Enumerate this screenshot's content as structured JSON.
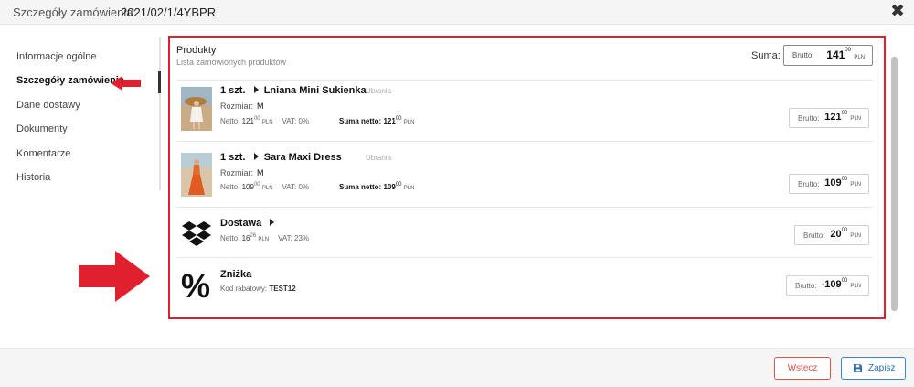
{
  "header": {
    "label": "Szczegóły zamówienia:",
    "order_id": "2021/02/1/4YBPR",
    "close_icon": "close-icon"
  },
  "nav": {
    "items": [
      {
        "label": "Informacje ogólne"
      },
      {
        "label": "Szczegóły zamówienia"
      },
      {
        "label": "Dane dostawy"
      },
      {
        "label": "Dokumenty"
      },
      {
        "label": "Komentarze"
      },
      {
        "label": "Historia"
      }
    ],
    "active_index": 1
  },
  "products": {
    "title": "Produkty",
    "subtitle": "Lista zamówionych produktów",
    "suma_label": "Suma:",
    "suma_brutto_label": "Brutto:",
    "suma_value": "141",
    "suma_cents": "00",
    "currency": "PLN",
    "items": [
      {
        "qty": "1 szt.",
        "name": "Lniana Mini Sukienka",
        "category": "Ubrania",
        "size_label": "Rozmiar:",
        "size": "M",
        "netto_label": "Netto:",
        "netto": "121",
        "netto_cents": "00",
        "vat": "VAT: 0%",
        "sum_netto_label": "Suma netto:",
        "sum_netto": "121",
        "sum_netto_cents": "00",
        "brutto_label": "Brutto:",
        "brutto": "121",
        "brutto_cents": "00"
      },
      {
        "qty": "1 szt.",
        "name": "Sara Maxi Dress",
        "category": "Ubrania",
        "size_label": "Rozmiar:",
        "size": "M",
        "netto_label": "Netto:",
        "netto": "109",
        "netto_cents": "00",
        "vat": "VAT: 0%",
        "sum_netto_label": "Suma netto:",
        "sum_netto": "109",
        "sum_netto_cents": "00",
        "brutto_label": "Brutto:",
        "brutto": "109",
        "brutto_cents": "00"
      }
    ],
    "delivery": {
      "name": "Dostawa",
      "icon": "dropbox-icon",
      "netto_label": "Netto:",
      "netto": "16",
      "netto_cents": "26",
      "vat": "VAT: 23%",
      "brutto_label": "Brutto:",
      "brutto": "20",
      "brutto_cents": "00"
    },
    "discount": {
      "name": "Zniżka",
      "icon": "percent-icon",
      "symbol": "%",
      "code_label": "Kod rabatowy:",
      "code": "TEST12",
      "brutto_label": "Brutto:",
      "brutto": "-109",
      "brutto_cents": "00"
    }
  },
  "footer": {
    "back_label": "Wstecz",
    "save_label": "Zapisz",
    "save_icon": "floppy-disk-icon"
  },
  "colors": {
    "highlight_red": "#e0202e",
    "back_red": "#d9534f",
    "save_blue": "#3a87c8"
  }
}
